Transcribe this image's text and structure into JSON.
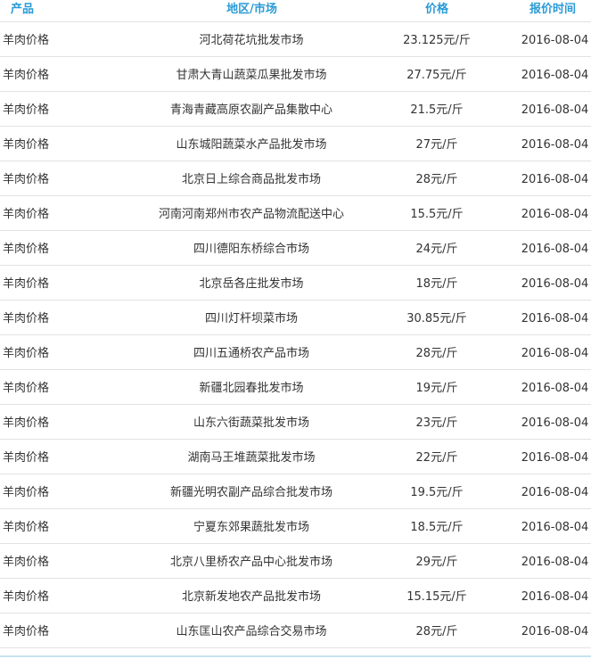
{
  "table": {
    "headers": {
      "product": "产品",
      "market": "地区/市场",
      "price": "价格",
      "date": "报价时间"
    },
    "rows": [
      {
        "product": "羊肉价格",
        "market": "河北荷花坑批发市场",
        "price": "23.125元/斤",
        "date": "2016-08-04"
      },
      {
        "product": "羊肉价格",
        "market": "甘肃大青山蔬菜瓜果批发市场",
        "price": "27.75元/斤",
        "date": "2016-08-04"
      },
      {
        "product": "羊肉价格",
        "market": "青海青藏高原农副产品集散中心",
        "price": "21.5元/斤",
        "date": "2016-08-04"
      },
      {
        "product": "羊肉价格",
        "market": "山东城阳蔬菜水产品批发市场",
        "price": "27元/斤",
        "date": "2016-08-04"
      },
      {
        "product": "羊肉价格",
        "market": "北京日上综合商品批发市场",
        "price": "28元/斤",
        "date": "2016-08-04"
      },
      {
        "product": "羊肉价格",
        "market": "河南河南郑州市农产品物流配送中心",
        "price": "15.5元/斤",
        "date": "2016-08-04"
      },
      {
        "product": "羊肉价格",
        "market": "四川德阳东桥综合市场",
        "price": "24元/斤",
        "date": "2016-08-04"
      },
      {
        "product": "羊肉价格",
        "market": "北京岳各庄批发市场",
        "price": "18元/斤",
        "date": "2016-08-04"
      },
      {
        "product": "羊肉价格",
        "market": "四川灯杆坝菜市场",
        "price": "30.85元/斤",
        "date": "2016-08-04"
      },
      {
        "product": "羊肉价格",
        "market": "四川五通桥农产品市场",
        "price": "28元/斤",
        "date": "2016-08-04"
      },
      {
        "product": "羊肉价格",
        "market": "新疆北园春批发市场",
        "price": "19元/斤",
        "date": "2016-08-04"
      },
      {
        "product": "羊肉价格",
        "market": "山东六街蔬菜批发市场",
        "price": "23元/斤",
        "date": "2016-08-04"
      },
      {
        "product": "羊肉价格",
        "market": "湖南马王堆蔬菜批发市场",
        "price": "22元/斤",
        "date": "2016-08-04"
      },
      {
        "product": "羊肉价格",
        "market": "新疆光明农副产品综合批发市场",
        "price": "19.5元/斤",
        "date": "2016-08-04"
      },
      {
        "product": "羊肉价格",
        "market": "宁夏东郊果蔬批发市场",
        "price": "18.5元/斤",
        "date": "2016-08-04"
      },
      {
        "product": "羊肉价格",
        "market": "北京八里桥农产品中心批发市场",
        "price": "29元/斤",
        "date": "2016-08-04"
      },
      {
        "product": "羊肉价格",
        "market": "北京新发地农产品批发市场",
        "price": "15.15元/斤",
        "date": "2016-08-04"
      },
      {
        "product": "羊肉价格",
        "market": "山东匡山农产品综合交易市场",
        "price": "28元/斤",
        "date": "2016-08-04"
      }
    ]
  }
}
